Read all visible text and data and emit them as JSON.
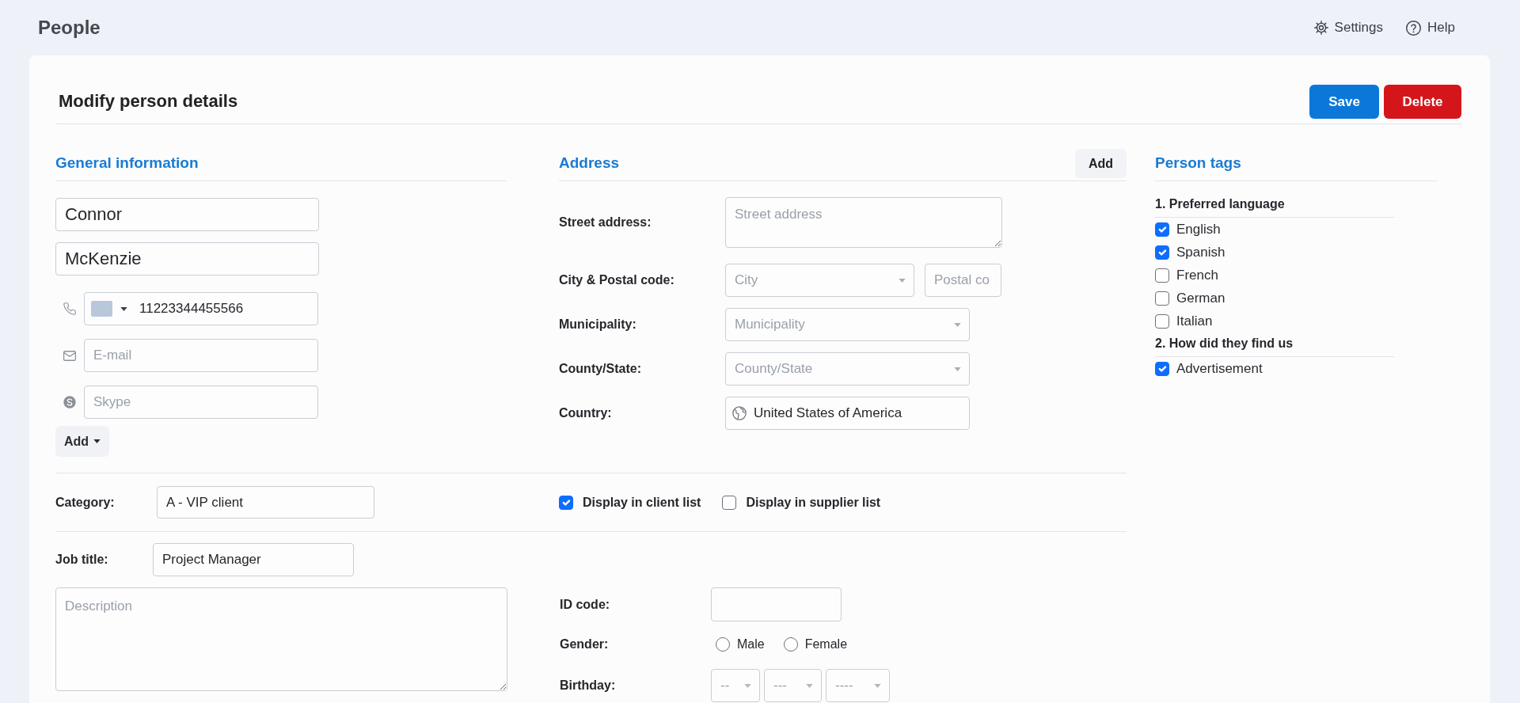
{
  "header": {
    "title": "People",
    "links": [
      {
        "label": "Settings"
      },
      {
        "label": "Help"
      }
    ]
  },
  "form": {
    "title": "Modify person details",
    "actions": [
      {
        "label": "Save",
        "kind": "primary"
      },
      {
        "label": "Delete",
        "kind": "danger"
      }
    ]
  },
  "general_information": {
    "heading": "General information",
    "first_name": "Connor",
    "last_name": "McKenzie",
    "contacts": [
      {
        "kind": "phone",
        "value": "11223344455566"
      },
      {
        "kind": "email",
        "placeholder": "E-mail"
      },
      {
        "kind": "skype",
        "placeholder": "Skype"
      }
    ],
    "add_button": "Add"
  },
  "address": {
    "heading": "Address",
    "add_button": "Add",
    "fields": [
      {
        "label": "Street address:",
        "controls": [
          {
            "kind": "textarea",
            "placeholder": "Street address"
          }
        ]
      },
      {
        "label": "City & Postal code:",
        "controls": [
          {
            "kind": "select",
            "placeholder": "City"
          },
          {
            "kind": "text",
            "placeholder": "Postal co"
          }
        ]
      },
      {
        "label": "Municipality:",
        "controls": [
          {
            "kind": "select",
            "placeholder": "Municipality"
          }
        ]
      },
      {
        "label": "County/State:",
        "controls": [
          {
            "kind": "select",
            "placeholder": "County/State"
          }
        ]
      },
      {
        "label": "Country:",
        "controls": [
          {
            "kind": "country",
            "value": "United States of America"
          }
        ]
      }
    ]
  },
  "category": {
    "label": "Category:",
    "value": "A - VIP client"
  },
  "list_options": [
    {
      "label": "Display in client list",
      "checked": true
    },
    {
      "label": "Display in supplier list",
      "checked": false
    }
  ],
  "job_title": {
    "label": "Job title:",
    "value": "Project Manager"
  },
  "description": {
    "placeholder": "Description"
  },
  "id_code": {
    "label": "ID code:"
  },
  "gender": {
    "label": "Gender:",
    "options": [
      {
        "label": "Male",
        "selected": false
      },
      {
        "label": "Female",
        "selected": false
      }
    ]
  },
  "birthday": {
    "label": "Birthday:",
    "selects": [
      {
        "placeholder": "--"
      },
      {
        "placeholder": "---"
      },
      {
        "placeholder": "----"
      }
    ]
  },
  "person_tags": {
    "heading": "Person tags",
    "groups": [
      {
        "title": "1. Preferred language",
        "tags": [
          {
            "label": "English",
            "checked": true
          },
          {
            "label": "Spanish",
            "checked": true
          },
          {
            "label": "French",
            "checked": false
          },
          {
            "label": "German",
            "checked": false
          },
          {
            "label": "Italian",
            "checked": false
          }
        ]
      },
      {
        "title": "2. How did they find us",
        "tags": [
          {
            "label": "Advertisement",
            "checked": true
          }
        ]
      }
    ]
  }
}
